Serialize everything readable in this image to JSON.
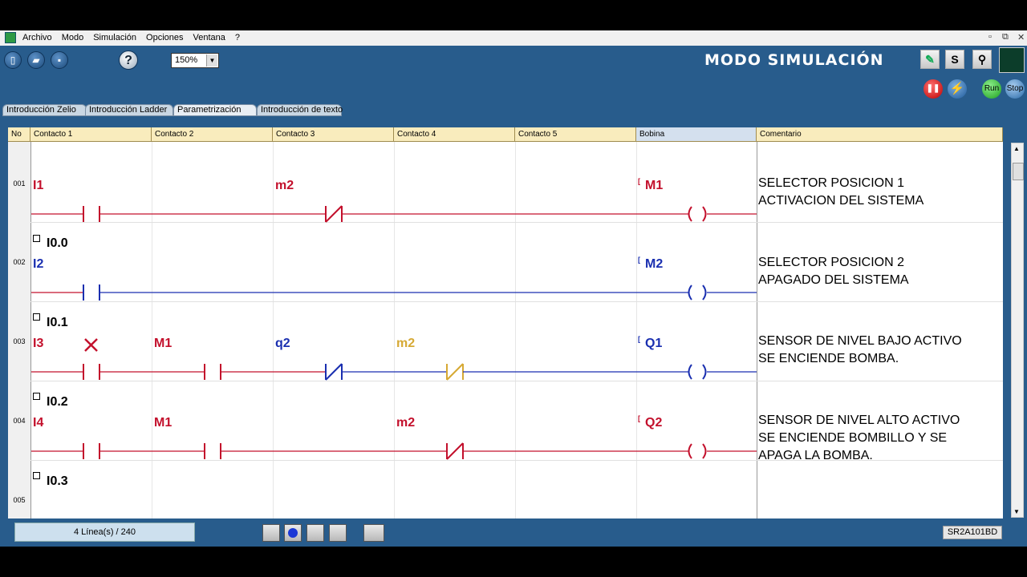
{
  "menu": {
    "items": [
      "Archivo",
      "Modo",
      "Simulación",
      "Opciones",
      "Ventana",
      "?"
    ]
  },
  "toolbar": {
    "zoom": "150%",
    "mode_title": "MODO SIMULACIÓN",
    "s_button": "S",
    "run_label": "Run",
    "stop_label": "Stop"
  },
  "tabs": [
    "Introducción Zelio",
    "Introducción Ladder",
    "Parametrización",
    "Introducción de texto"
  ],
  "grid": {
    "headers": [
      "No",
      "Contacto 1",
      "Contacto 2",
      "Contacto 3",
      "Contacto 4",
      "Contacto 5",
      "Bobina",
      "Comentario"
    ],
    "rows": [
      {
        "num": "001",
        "c1": "I1",
        "c1_addr": "I0.0",
        "c3": "m2",
        "coil": "M1",
        "comment": "SELECTOR POSICION 1\nACTIVACION DEL SISTEMA"
      },
      {
        "num": "002",
        "c1": "I2",
        "c1_addr": "I0.1",
        "coil": "M2",
        "comment": "SELECTOR POSICION 2\nAPAGADO DEL SISTEMA"
      },
      {
        "num": "003",
        "c1": "I3",
        "c1_addr": "I0.2",
        "c2": "M1",
        "c3": "q2",
        "c4": "m2",
        "coil": "Q1",
        "comment": "SENSOR DE NIVEL BAJO ACTIVO\nSE ENCIENDE BOMBA."
      },
      {
        "num": "004",
        "c1": "I4",
        "c1_addr": "I0.3",
        "c2": "M1",
        "c4": "m2",
        "coil": "Q2",
        "comment": "SENSOR DE NIVEL ALTO ACTIVO\nSE ENCIENDE BOMBILLO Y SE\nAPAGA LA BOMBA."
      },
      {
        "num": "005"
      }
    ]
  },
  "status": {
    "lines": "4 Línea(s) / 240",
    "model": "SR2A101BD"
  },
  "colors": {
    "active": "#c3102c",
    "inactive": "#1a2fb0",
    "forced": "#d6a934",
    "background": "#285c8c"
  }
}
